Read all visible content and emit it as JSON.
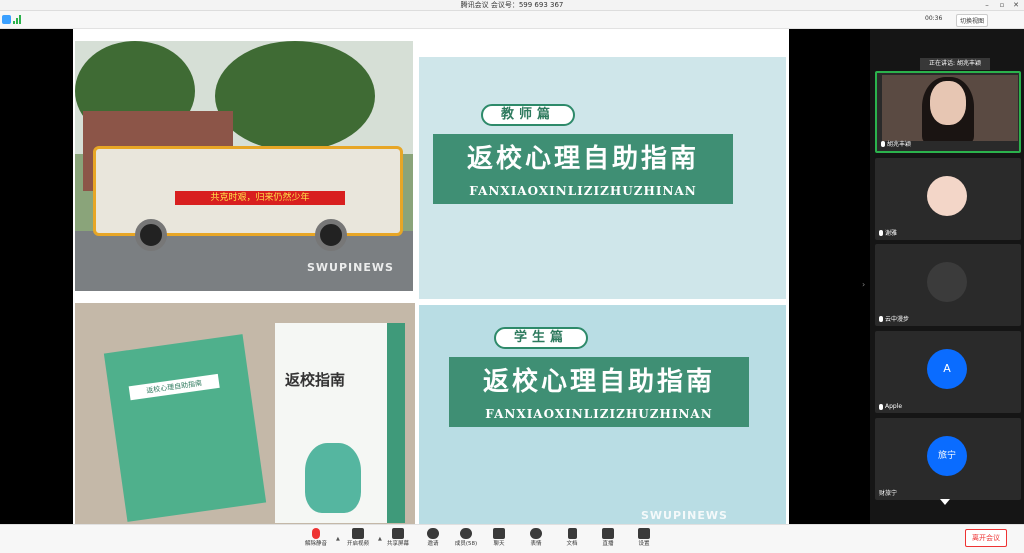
{
  "window": {
    "title": "腾讯会议 会议号：599 693 367"
  },
  "topbar": {
    "timer": "00:36",
    "switch_view": "切换视图"
  },
  "share": {
    "banner_text": "共克时艰，归来仍然少年",
    "watermark": "SWUPINEWS",
    "teacher_badge": "教师篇",
    "student_badge": "学生篇",
    "guide_title": "返校心理自助指南",
    "guide_pinyin": "FANXIAOXINLIZIZHUZHINAN",
    "book_small_label": "返校心理自助指南",
    "book_title": "返校指南"
  },
  "panel": {
    "speaking": "正在讲话: 胡兆丰颖",
    "participants": [
      {
        "name": "胡兆丰颖",
        "type": "video"
      },
      {
        "name": "谢雅",
        "type": "avatar"
      },
      {
        "name": "云中漫步",
        "type": "avatar"
      },
      {
        "name": "Apple",
        "type": "letter",
        "letter": "A"
      },
      {
        "name": "财旅宁",
        "type": "letter",
        "letter": "旅宁"
      }
    ]
  },
  "toolbar": {
    "unmute": "解除静音",
    "video": "开启视频",
    "share": "共享屏幕",
    "invite": "邀请",
    "members": "成员(58)",
    "chat": "聊天",
    "reactions": "表情",
    "docs": "文档",
    "live": "直播",
    "settings": "设置",
    "leave": "离开会议"
  },
  "colors": {
    "accent_green": "#2bb24c",
    "leave_red": "#e33333",
    "avatar_blue": "#0a6cff"
  }
}
